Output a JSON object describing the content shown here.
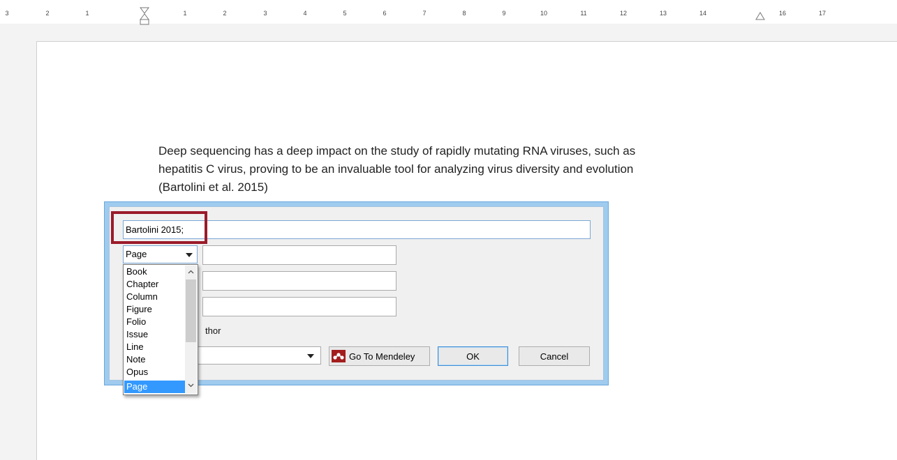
{
  "ruler": {
    "left_labels": [
      "3",
      "2",
      "1"
    ],
    "right_labels": [
      "1",
      "2",
      "3",
      "4",
      "5",
      "6",
      "7",
      "8",
      "9",
      "10",
      "11",
      "12",
      "13",
      "14",
      "16",
      "17"
    ]
  },
  "document": {
    "lines": [
      "Deep sequencing has a deep impact on the study of rapidly mutating RNA viruses, such as",
      "hepatitis C virus, proving to be an invaluable tool for analyzing virus diversity and evolution",
      "(Bartolini et al. 2015)"
    ]
  },
  "dialog": {
    "citation_value": "Bartolini 2015;",
    "locator_selected": "Page",
    "suppress_author_label_visible": "thor",
    "mendeley_button": "Go To Mendeley",
    "ok_button": "OK",
    "cancel_button": "Cancel"
  },
  "dropdown": {
    "options": [
      "Book",
      "Chapter",
      "Column",
      "Figure",
      "Folio",
      "Issue",
      "Line",
      "Note",
      "Opus",
      "Page"
    ],
    "selected": "Page"
  },
  "colors": {
    "highlight_border": "#9b1b2a",
    "dialog_frame": "#9fcbef",
    "selection": "#3399ff",
    "mendeley_logo": "#a31d1d"
  }
}
